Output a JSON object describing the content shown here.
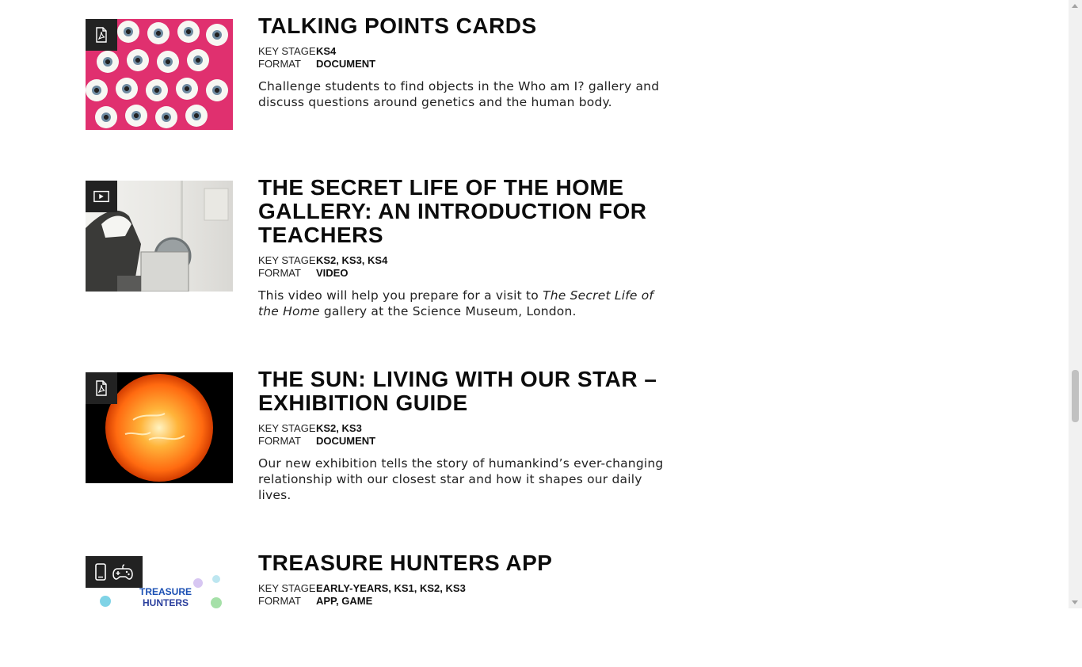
{
  "labels": {
    "key_stage": "KEY STAGE",
    "format": "FORMAT"
  },
  "resources": [
    {
      "title": "TALKING POINTS CARDS",
      "key_stage": "KS4",
      "format": "DOCUMENT",
      "description": "Challenge students to find objects in the Who am I? gallery and discuss questions around genetics and the human body.",
      "icons": [
        "pdf-icon"
      ]
    },
    {
      "title": "THE SECRET LIFE OF THE HOME GALLERY: AN INTRODUCTION FOR TEACHERS",
      "key_stage": "KS2, KS3, KS4",
      "format": "VIDEO",
      "description_prefix": "This video will help you prepare for a visit to ",
      "description_italic": "The Secret Life of the Home",
      "description_suffix": " gallery at the Science Museum, London.",
      "icons": [
        "video-icon"
      ]
    },
    {
      "title": "THE SUN: LIVING WITH OUR STAR – EXHIBITION GUIDE",
      "key_stage": "KS2, KS3",
      "format": "DOCUMENT",
      "description": "Our new exhibition tells the story of humankind’s ever-changing relationship with our closest star and how it shapes our daily lives.",
      "icons": [
        "pdf-icon"
      ]
    },
    {
      "title": "TREASURE HUNTERS APP",
      "key_stage": "EARLY-YEARS, KS1, KS2, KS3",
      "format": "APP, GAME",
      "thumb_text_line1": "TREASURE",
      "thumb_text_line2": "HUNTERS",
      "icons": [
        "mobile-icon",
        "gamepad-icon"
      ]
    }
  ]
}
